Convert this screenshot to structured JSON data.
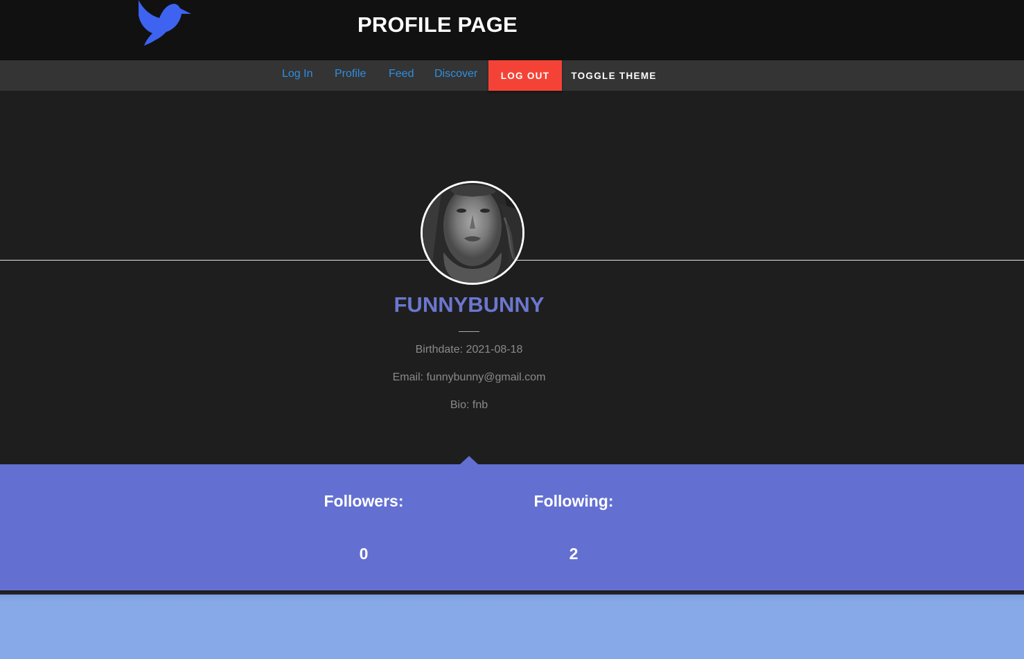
{
  "header": {
    "title": "PROFILE PAGE",
    "logo_icon": "dove-icon",
    "logo_color": "#3d63f0"
  },
  "nav": {
    "links": [
      {
        "label": "Log In"
      },
      {
        "label": "Profile"
      },
      {
        "label": "Feed"
      },
      {
        "label": "Discover"
      }
    ],
    "logout_label": "LOG OUT",
    "toggle_label": "TOGGLE THEME",
    "link_color": "#2f8fe0",
    "logout_color": "#f44336"
  },
  "profile": {
    "username": "FUNNYBUNNY",
    "birthdate": "Birthdate: 2021-08-18",
    "email": "Email: funnybunny@gmail.com",
    "bio": "Bio: fnb",
    "accent_color": "#6b77cf"
  },
  "stats": {
    "followers_label": "Followers:",
    "followers_value": "0",
    "following_label": "Following:",
    "following_value": "2",
    "band_color": "#6370d1"
  }
}
